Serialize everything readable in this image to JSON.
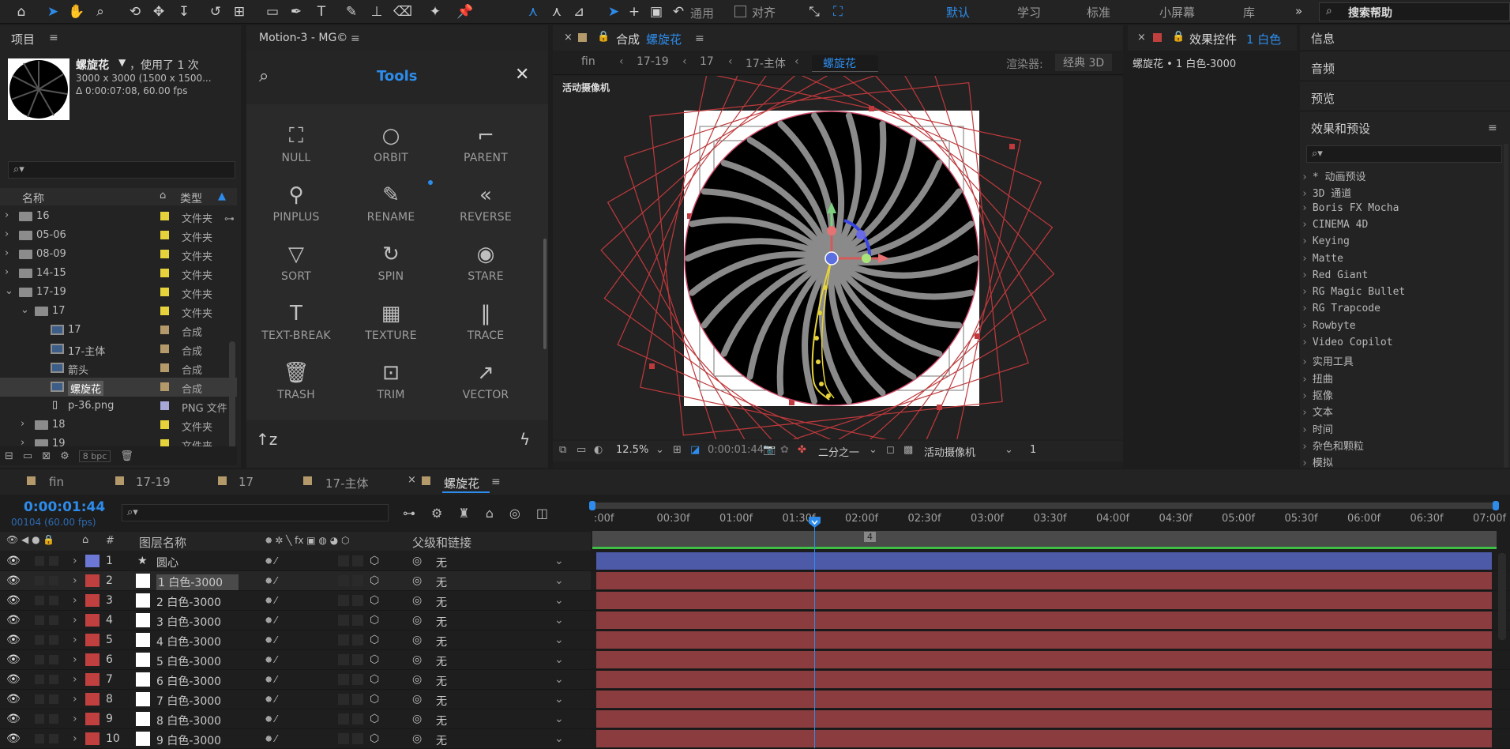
{
  "toolbar": {
    "workspaces": [
      "默认",
      "学习",
      "标准",
      "小屏幕",
      "库"
    ],
    "active_workspace": "默认",
    "general_label": "通用",
    "align_label": "对齐",
    "search_help": "搜索帮助",
    "more": "»"
  },
  "project": {
    "title": "项目",
    "comp_name": "螺旋花",
    "used_text": "，使用了 1 次",
    "dims": "3000 x 3000 (1500 x 1500...",
    "duration": "Δ 0:00:07:08, 60.00 fps",
    "col_name": "名称",
    "col_type": "类型",
    "bpc": "8 bpc",
    "items": [
      {
        "name": "16",
        "type": "文件夹",
        "kind": "folder",
        "indent": 0,
        "color": "#e6d33c",
        "expand": "›"
      },
      {
        "name": "05-06",
        "type": "文件夹",
        "kind": "folder",
        "indent": 0,
        "color": "#e6d33c",
        "expand": "›"
      },
      {
        "name": "08-09",
        "type": "文件夹",
        "kind": "folder",
        "indent": 0,
        "color": "#e6d33c",
        "expand": "›"
      },
      {
        "name": "14-15",
        "type": "文件夹",
        "kind": "folder",
        "indent": 0,
        "color": "#e6d33c",
        "expand": "›"
      },
      {
        "name": "17-19",
        "type": "文件夹",
        "kind": "folder",
        "indent": 0,
        "color": "#e6d33c",
        "expand": "⌄"
      },
      {
        "name": "17",
        "type": "文件夹",
        "kind": "folder",
        "indent": 1,
        "color": "#e6d33c",
        "expand": "⌄"
      },
      {
        "name": "17",
        "type": "合成",
        "kind": "comp",
        "indent": 2,
        "color": "#b49a6b",
        "expand": ""
      },
      {
        "name": "17-主体",
        "type": "合成",
        "kind": "comp",
        "indent": 2,
        "color": "#b49a6b",
        "expand": ""
      },
      {
        "name": "箭头",
        "type": "合成",
        "kind": "comp",
        "indent": 2,
        "color": "#b49a6b",
        "expand": ""
      },
      {
        "name": "螺旋花",
        "type": "合成",
        "kind": "comp",
        "indent": 2,
        "color": "#b49a6b",
        "expand": "",
        "selected": true
      },
      {
        "name": "p-36.png",
        "type": "PNG 文件",
        "kind": "file",
        "indent": 2,
        "color": "#a7a7d8",
        "expand": ""
      },
      {
        "name": "18",
        "type": "文件夹",
        "kind": "folder",
        "indent": 1,
        "color": "#e6d33c",
        "expand": "›"
      },
      {
        "name": "19",
        "type": "文件夹",
        "kind": "folder",
        "indent": 1,
        "color": "#e6d33c",
        "expand": "›"
      }
    ]
  },
  "motion": {
    "title": "Motion-3 - MG©",
    "header": "Tools",
    "tools": [
      "NULL",
      "ORBIT",
      "PARENT",
      "PINPLUS",
      "RENAME",
      "REVERSE",
      "SORT",
      "SPIN",
      "STARE",
      "TEXT-BREAK",
      "TEXTURE",
      "TRACE",
      "TRASH",
      "TRIM",
      "VECTOR"
    ],
    "tool_icons": [
      "⛶",
      "○",
      "⌐",
      "⚲",
      "✎",
      "«",
      "▽",
      "↻",
      "◉",
      "T",
      "▦",
      "‖",
      "🗑",
      "⊡",
      "↗"
    ],
    "sort_icon": "↑z",
    "flash_icon": "ϟ"
  },
  "comp": {
    "title_prefix": "合成",
    "title_name": "螺旋花",
    "breadcrumbs": [
      "fin",
      "17-19",
      "17",
      "17-主体",
      "螺旋花"
    ],
    "renderer_label": "渲染器:",
    "renderer": "经典 3D",
    "camera_label": "活动摄像机",
    "zoom": "12.5%",
    "timecode": "0:00:01:44",
    "resolution": "二分之一",
    "camera_select": "活动摄像机",
    "views": "1"
  },
  "effects": {
    "title": "效果控件",
    "title_suffix": "1 白色",
    "layer": "螺旋花 • 1 白色-3000"
  },
  "right_panels": {
    "info": "信息",
    "audio": "音频",
    "preview": "预览",
    "effects_presets": "效果和预设",
    "items": [
      "* 动画预设",
      "3D 通道",
      "Boris FX Mocha",
      "CINEMA 4D",
      "Keying",
      "Matte",
      "Red Giant",
      "RG Magic Bullet",
      "RG Trapcode",
      "Rowbyte",
      "Video Copilot",
      "实用工具",
      "扭曲",
      "抠像",
      "文本",
      "时间",
      "杂色和颗粒",
      "模拟"
    ]
  },
  "timeline": {
    "tabs": [
      "fin",
      "17-19",
      "17",
      "17-主体",
      "螺旋花"
    ],
    "timecode": "0:00:01:44",
    "frame_info": "00104 (60.00 fps)",
    "col_layer_name": "图层名称",
    "col_parent": "父级和链接",
    "col_hash": "#",
    "ruler": [
      ":00f",
      "00:30f",
      "01:00f",
      "01:30f",
      "02:00f",
      "02:30f",
      "03:00f",
      "03:30f",
      "04:00f",
      "04:30f",
      "05:00f",
      "05:30f",
      "06:00f",
      "06:30f",
      "07:00f"
    ],
    "marker": "4",
    "layers": [
      {
        "num": "1",
        "name": "圆心",
        "parent": "无",
        "label": "#6d77d6",
        "kind": "null"
      },
      {
        "num": "2",
        "name": "1 白色-3000",
        "parent": "无",
        "label": "#c04040",
        "kind": "solid"
      },
      {
        "num": "3",
        "name": "2 白色-3000",
        "parent": "无",
        "label": "#c04040",
        "kind": "solid"
      },
      {
        "num": "4",
        "name": "3 白色-3000",
        "parent": "无",
        "label": "#c04040",
        "kind": "solid"
      },
      {
        "num": "5",
        "name": "4 白色-3000",
        "parent": "无",
        "label": "#c04040",
        "kind": "solid"
      },
      {
        "num": "6",
        "name": "5 白色-3000",
        "parent": "无",
        "label": "#c04040",
        "kind": "solid"
      },
      {
        "num": "7",
        "name": "6 白色-3000",
        "parent": "无",
        "label": "#c04040",
        "kind": "solid"
      },
      {
        "num": "8",
        "name": "7 白色-3000",
        "parent": "无",
        "label": "#c04040",
        "kind": "solid"
      },
      {
        "num": "9",
        "name": "8 白色-3000",
        "parent": "无",
        "label": "#c04040",
        "kind": "solid"
      },
      {
        "num": "10",
        "name": "9 白色-3000",
        "parent": "无",
        "label": "#c04040",
        "kind": "solid"
      }
    ]
  },
  "colors": {
    "accent": "#2d8ceb",
    "bar_red": "#8a3c3e",
    "bar_blue": "#4c5aa8"
  }
}
